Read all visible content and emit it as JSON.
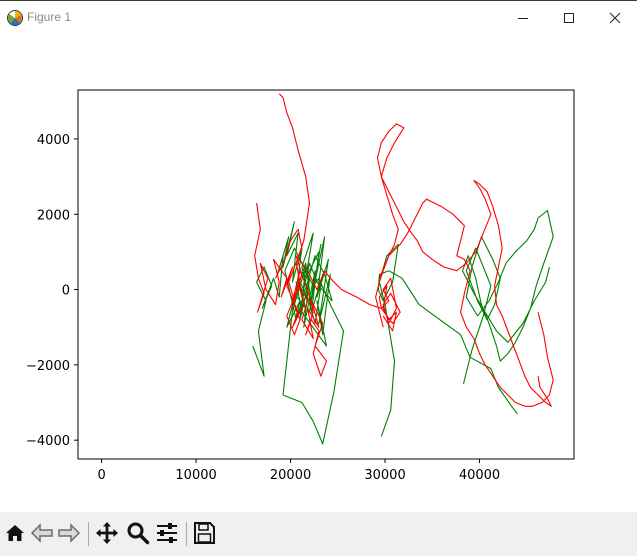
{
  "window": {
    "title": "Figure 1",
    "icon": "matplotlib-figure-icon",
    "controls": [
      "minimize-icon",
      "maximize-icon",
      "close-icon"
    ]
  },
  "toolbar": {
    "buttons": [
      {
        "name": "home-button",
        "icon": "home-icon"
      },
      {
        "name": "back-button",
        "icon": "back-arrow-icon"
      },
      {
        "name": "forward-button",
        "icon": "forward-arrow-icon"
      },
      {
        "name": "pan-button",
        "icon": "pan-move-icon"
      },
      {
        "name": "zoom-button",
        "icon": "zoom-magnifier-icon"
      },
      {
        "name": "configure-subplots-button",
        "icon": "sliders-icon"
      },
      {
        "name": "save-button",
        "icon": "floppy-disk-icon"
      }
    ]
  },
  "chart_data": {
    "type": "line",
    "title": "",
    "xlabel": "",
    "ylabel": "",
    "xlim": [
      -2500,
      50000
    ],
    "ylim": [
      -4500,
      5300
    ],
    "xticks": [
      0,
      10000,
      20000,
      30000,
      40000
    ],
    "yticks": [
      -4000,
      -2000,
      0,
      2000,
      4000
    ],
    "xtick_labels": [
      "0",
      "10000",
      "20000",
      "30000",
      "40000"
    ],
    "ytick_labels": [
      "−4000",
      "−2000",
      "0",
      "2000",
      "4000"
    ],
    "grid": false,
    "legend": "none",
    "series": [
      {
        "color": "#008000",
        "x": [
          16000,
          17200,
          16600,
          17400,
          16400,
          17200,
          18000,
          17000,
          18200,
          18800,
          19200,
          18600,
          19800,
          19200,
          20400,
          19600,
          20800,
          20200,
          21200,
          20400,
          21600,
          21000,
          22000,
          21400,
          22600,
          22000,
          23200,
          22400,
          23600,
          22800,
          24000,
          23000,
          24200,
          23400,
          22800,
          23800,
          21200,
          20600,
          22200,
          21600,
          20400,
          19600,
          21000,
          20400,
          21800,
          21200,
          22400,
          21600,
          23000,
          22200,
          23400,
          22600,
          21800,
          20800,
          21600,
          20400,
          19200,
          21200,
          22400,
          23400,
          24600,
          25600,
          24200,
          23000,
          22400,
          21200,
          20400,
          19400,
          20600,
          21800,
          22600,
          23600,
          24400,
          23000,
          22000,
          21200
        ],
        "y": [
          -1500,
          -2300,
          -1100,
          -300,
          200,
          600,
          100,
          -500,
          300,
          -200,
          900,
          400,
          1400,
          600,
          1800,
          900,
          1500,
          200,
          1100,
          -400,
          600,
          -800,
          300,
          -1000,
          500,
          -600,
          1200,
          0,
          1400,
          -200,
          800,
          -900,
          400,
          -1200,
          -300,
          -1500,
          -600,
          200,
          -400,
          700,
          -200,
          -1000,
          -300,
          -900,
          -100,
          600,
          1500,
          300,
          1000,
          -600,
          400,
          -900,
          -200,
          300,
          -500,
          -100,
          -2800,
          -3000,
          -3500,
          -4100,
          -2700,
          -1100,
          -400,
          300,
          100,
          700,
          1100,
          500,
          -800,
          200,
          900,
          400,
          -300,
          100,
          700,
          -200
        ]
      },
      {
        "color": "#008000",
        "x": [
          29600,
          30600,
          31000,
          30000,
          29400,
          30200,
          31400,
          30800,
          29800,
          29300,
          29400,
          30400,
          31800,
          33600,
          35800,
          38000,
          39000,
          41200,
          42000,
          43400,
          44000
        ],
        "y": [
          -3900,
          -3200,
          -1900,
          -400,
          200,
          900,
          1200,
          200,
          -300,
          0,
          400,
          500,
          300,
          -400,
          -800,
          -1200,
          -1800,
          -2100,
          -2600,
          -3100,
          -3300
        ]
      },
      {
        "color": "#008000",
        "x": [
          38300,
          39200,
          40400,
          41200,
          40400,
          39600,
          38600,
          39800,
          40800,
          41600,
          42200,
          41400,
          40200,
          39200,
          38600,
          39800,
          41000,
          42000,
          42800,
          43800,
          45000,
          45800,
          46200,
          47200,
          47800,
          46800,
          46000,
          45400,
          44600,
          43800,
          43000,
          42200,
          41800,
          41000,
          40200,
          39600,
          38800,
          38200,
          39400,
          40600,
          41800,
          43000,
          44600,
          45800,
          47000,
          47400
        ],
        "y": [
          -2500,
          -1600,
          -700,
          100,
          600,
          1100,
          500,
          -300,
          -800,
          -400,
          300,
          800,
          1400,
          600,
          -200,
          -700,
          -300,
          200,
          700,
          1000,
          1300,
          1600,
          1900,
          2100,
          1400,
          700,
          100,
          -500,
          -1000,
          -1400,
          -1700,
          -1900,
          -1500,
          -900,
          -400,
          300,
          900,
          500,
          -100,
          -600,
          -1100,
          -1400,
          -900,
          -300,
          200,
          600
        ]
      },
      {
        "color": "#ff0000",
        "x": [
          16400,
          16800,
          16200,
          16600,
          17200,
          16500,
          17000,
          17600,
          16800,
          17400,
          18400,
          18800,
          18200,
          19600,
          19000,
          20200,
          19600,
          20800,
          20200,
          21400,
          20800,
          21800,
          21200,
          22400,
          21800,
          23000,
          22200,
          23400,
          22600,
          23800,
          23200,
          22400,
          23000,
          22200,
          21600,
          22400,
          21800,
          21000,
          20200,
          21000,
          20400,
          19600,
          20400,
          21200,
          20600,
          21800,
          22800,
          23600,
          24200,
          25400,
          27000,
          28400,
          29600,
          30400,
          29800,
          30600,
          31200,
          30400,
          29800,
          30600,
          31600,
          30800,
          29600,
          29400,
          30200,
          29800,
          30400,
          31200,
          30800,
          29800
        ],
        "y": [
          2300,
          1600,
          900,
          300,
          -100,
          -600,
          -200,
          300,
          700,
          0,
          -400,
          200,
          800,
          300,
          -200,
          600,
          100,
          -600,
          -1000,
          -400,
          200,
          -300,
          -800,
          -1300,
          -500,
          -1000,
          -300,
          -900,
          -1500,
          -1900,
          -2300,
          -1700,
          -1100,
          -800,
          -1200,
          -600,
          0,
          500,
          -300,
          -800,
          -1200,
          -700,
          -200,
          400,
          900,
          500,
          0,
          500,
          300,
          0,
          -200,
          -400,
          -500,
          -300,
          0,
          300,
          -500,
          -900,
          -400,
          -100,
          -600,
          -900,
          -500,
          -200,
          100,
          -500,
          -800,
          -600,
          -1100,
          -700
        ]
      },
      {
        "color": "#ff0000",
        "x": [
          18400,
          19200,
          20000,
          20800,
          21200,
          20400,
          19800,
          20400,
          21000,
          20600,
          21400,
          22000,
          21600,
          20800,
          20200,
          19600,
          19200,
          18800
        ],
        "y": [
          300,
          700,
          1300,
          1600,
          1100,
          600,
          200,
          -300,
          200,
          700,
          1300,
          2300,
          3000,
          3700,
          4300,
          4700,
          5100,
          5200
        ]
      },
      {
        "color": "#ff0000",
        "x": [
          29400,
          30400,
          31600,
          32400,
          33000,
          33600,
          34000,
          34400,
          35200,
          36000,
          37200,
          38400,
          38000,
          37600,
          38400,
          39000,
          38400,
          38000,
          38600,
          39400,
          40000,
          40600,
          41400,
          42200,
          43000,
          43800,
          44800,
          45600,
          46600,
          47400,
          47800,
          47200,
          46800,
          46200
        ],
        "y": [
          300,
          900,
          1200,
          1500,
          1800,
          2100,
          2300,
          2400,
          2300,
          2200,
          2000,
          1700,
          1300,
          900,
          800,
          500,
          -100,
          -600,
          -1000,
          -1300,
          -1700,
          -2000,
          -2300,
          -2600,
          -2800,
          -3000,
          -3100,
          -3100,
          -3000,
          -2800,
          -2400,
          -1800,
          -1200,
          -600
        ]
      },
      {
        "color": "#ff0000",
        "x": [
          29800,
          29400,
          29000,
          29400,
          29800,
          30400,
          31000,
          31400,
          30800,
          30200,
          29600,
          30200,
          31000,
          32000,
          31200,
          30400,
          29600,
          29200,
          29600,
          30400,
          31200,
          32000,
          32800,
          33400,
          34000,
          35000,
          36200,
          37600,
          38600,
          39600,
          40400,
          41200,
          40600,
          40000,
          39400,
          40000,
          40800,
          41400,
          42000,
          42400,
          42000,
          41600,
          41800,
          42400,
          43000,
          43600,
          44200,
          44800,
          45400,
          46200,
          47000,
          47600,
          47200,
          46400,
          46200
        ],
        "y": [
          -1000,
          -600,
          -200,
          200,
          500,
          900,
          1200,
          1600,
          2000,
          2500,
          3000,
          3500,
          3900,
          4300,
          4400,
          4200,
          3900,
          3500,
          3000,
          2600,
          2200,
          1800,
          1500,
          1300,
          1000,
          800,
          600,
          500,
          700,
          1000,
          1500,
          2000,
          2400,
          2700,
          2900,
          2800,
          2600,
          2200,
          1700,
          1100,
          600,
          100,
          -400,
          -700,
          -1100,
          -1500,
          -1900,
          -2300,
          -2600,
          -2800,
          -3000,
          -3100,
          -2900,
          -2600,
          -2300
        ]
      }
    ]
  }
}
